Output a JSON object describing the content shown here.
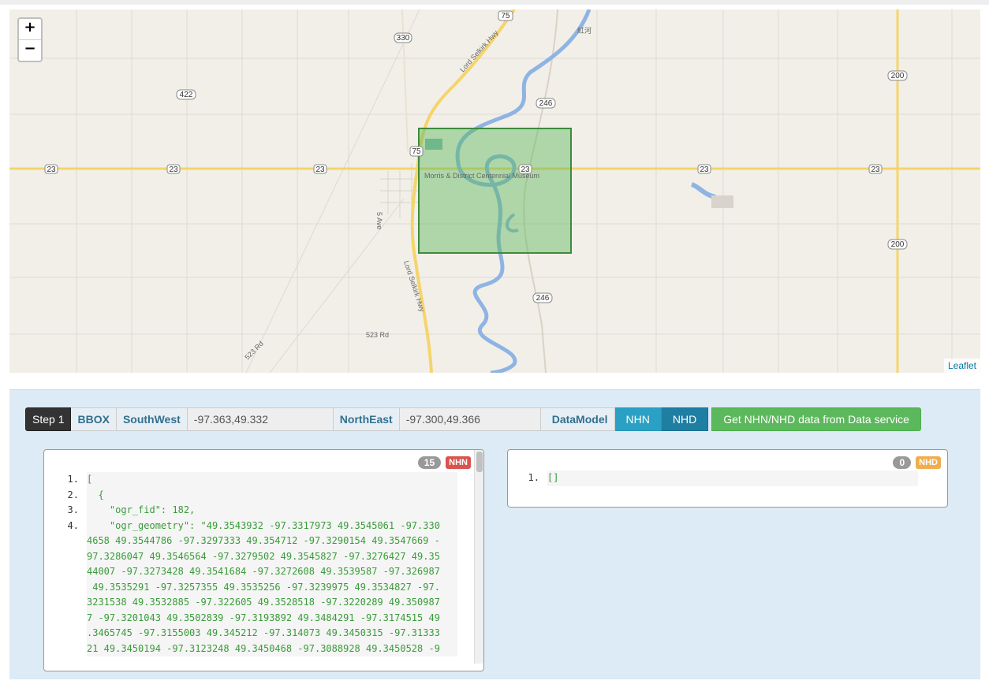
{
  "map": {
    "zoom_in": "+",
    "zoom_out": "−",
    "attribution": "Leaflet",
    "labels": {
      "hwy75": "75",
      "hwy330": "330",
      "hwy422": "422",
      "hwy246a": "246",
      "hwy246b": "246",
      "hwy200a": "200",
      "hwy200b": "200",
      "hwy23": "23",
      "lord_selkirk_top": "Lord Selkirk Hwy",
      "lord_selkirk_bottom": "Lord Selkirk Hwy",
      "museum": "Morris & District Centennial Museum",
      "ave5": "5 Ave",
      "rd523a": "523 Rd",
      "rd523b": "523 Rd",
      "cjk": "紅河"
    },
    "bbox_color": "#5cb85c",
    "river_color": "#8fb4e3",
    "road_color": "#f5d46a"
  },
  "toolbar": {
    "step": "Step 1",
    "bbox": "BBOX",
    "southwest_label": "SouthWest",
    "southwest_value": "-97.363,49.332",
    "northeast_label": "NorthEast",
    "northeast_value": "-97.300,49.366",
    "datamodel_label": "DataModel",
    "nhn_button": "NHN",
    "nhd_button": "NHD",
    "get_button": "Get NHN/NHD data from Data service"
  },
  "nhn_panel": {
    "count": "15",
    "tag": "NHN",
    "tag_color": "#d9534f",
    "lines": [
      {
        "n": "1.",
        "t": "["
      },
      {
        "n": "2.",
        "t": "  {"
      },
      {
        "n": "3.",
        "t": "    \"ogr_fid\": 182,"
      },
      {
        "n": "4.",
        "t": "    \"ogr_geometry\": \"49.3543932 -97.3317973 49.3545061 -97.330"
      },
      {
        "n": "",
        "t": "4658 49.3544786 -97.3297333 49.354712 -97.3290154 49.3547669 -"
      },
      {
        "n": "",
        "t": "97.3286047 49.3546564 -97.3279502 49.3545827 -97.3276427 49.35"
      },
      {
        "n": "",
        "t": "44007 -97.3273428 49.3541684 -97.3272608 49.3539587 -97.326987"
      },
      {
        "n": "",
        "t": " 49.3535291 -97.3257355 49.3535256 -97.3239975 49.3534827 -97."
      },
      {
        "n": "",
        "t": "3231538 49.3532885 -97.322605 49.3528518 -97.3220289 49.350987"
      },
      {
        "n": "",
        "t": "7 -97.3201043 49.3502839 -97.3193892 49.3484291 -97.3174515 49"
      },
      {
        "n": "",
        "t": ".3465745 -97.3155003 49.345212 -97.314073 49.3450315 -97.31333"
      },
      {
        "n": "",
        "t": "21 49.3450194 -97.3123248 49.3450468 -97.3088928 49.3450528 -9"
      }
    ]
  },
  "nhd_panel": {
    "count": "0",
    "tag": "NHD",
    "tag_color": "#f0ad4e",
    "lines": [
      {
        "n": "1.",
        "t": "[]"
      }
    ]
  }
}
